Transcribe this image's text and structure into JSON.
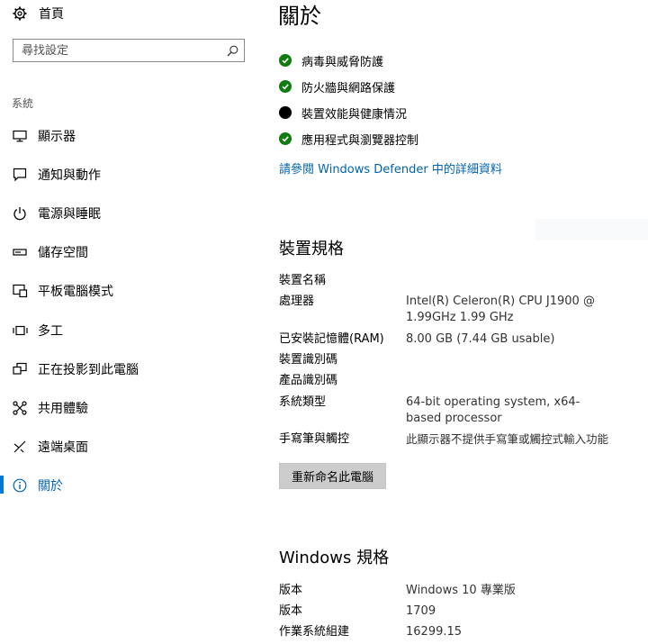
{
  "sidebar": {
    "home_label": "首頁",
    "search": {
      "placeholder": "尋找設定",
      "value": ""
    },
    "section_label": "系統",
    "items": [
      {
        "icon": "monitor-icon",
        "label": "顯示器"
      },
      {
        "icon": "notification-icon",
        "label": "通知與動作"
      },
      {
        "icon": "power-icon",
        "label": "電源與睡眠"
      },
      {
        "icon": "storage-icon",
        "label": "儲存空間"
      },
      {
        "icon": "tablet-mode-icon",
        "label": "平板電腦模式"
      },
      {
        "icon": "multitasking-icon",
        "label": "多工"
      },
      {
        "icon": "project-icon",
        "label": "正在投影到此電腦"
      },
      {
        "icon": "shared-experiences-icon",
        "label": "共用體驗"
      },
      {
        "icon": "remote-desktop-icon",
        "label": "遠端桌面"
      },
      {
        "icon": "info-icon",
        "label": "關於",
        "active": true
      }
    ]
  },
  "main": {
    "title": "關於",
    "security": {
      "items": [
        {
          "label": "病毒與威脅防護",
          "status": "ok"
        },
        {
          "label": "防火牆與網路保護",
          "status": "ok"
        },
        {
          "label": "裝置效能與健康情況",
          "status": "attention"
        },
        {
          "label": "應用程式與瀏覽器控制",
          "status": "ok"
        }
      ],
      "link": "請參閱 Windows Defender 中的詳細資料"
    },
    "device_specs": {
      "heading": "裝置規格",
      "rows": [
        {
          "label": "裝置名稱",
          "value": ""
        },
        {
          "label": "處理器",
          "value": "Intel(R) Celeron(R) CPU  J1900  @ 1.99GHz 1.99 GHz"
        },
        {
          "label": "已安裝記憶體(RAM)",
          "value": "8.00 GB (7.44 GB usable)"
        },
        {
          "label": "裝置識別碼",
          "value": ""
        },
        {
          "label": "產品識別碼",
          "value": ""
        },
        {
          "label": "系統類型",
          "value": "64-bit operating system, x64-based processor"
        },
        {
          "label": "手寫筆與觸控",
          "value": "此顯示器不提供手寫筆或觸控式輸入功能"
        }
      ],
      "rename_button": "重新命名此電腦"
    },
    "windows_specs": {
      "heading": "Windows 規格",
      "rows": [
        {
          "label": "版本",
          "value": "Windows 10 專業版"
        },
        {
          "label": "版本",
          "value": "1709"
        },
        {
          "label": "作業系統組建",
          "value": "16299.15"
        }
      ]
    }
  },
  "colors": {
    "accent": "#0078d7",
    "link": "#0063b1",
    "status_ok": "#107c10",
    "status_attention": "#000000",
    "button_bg": "#cccccc"
  }
}
